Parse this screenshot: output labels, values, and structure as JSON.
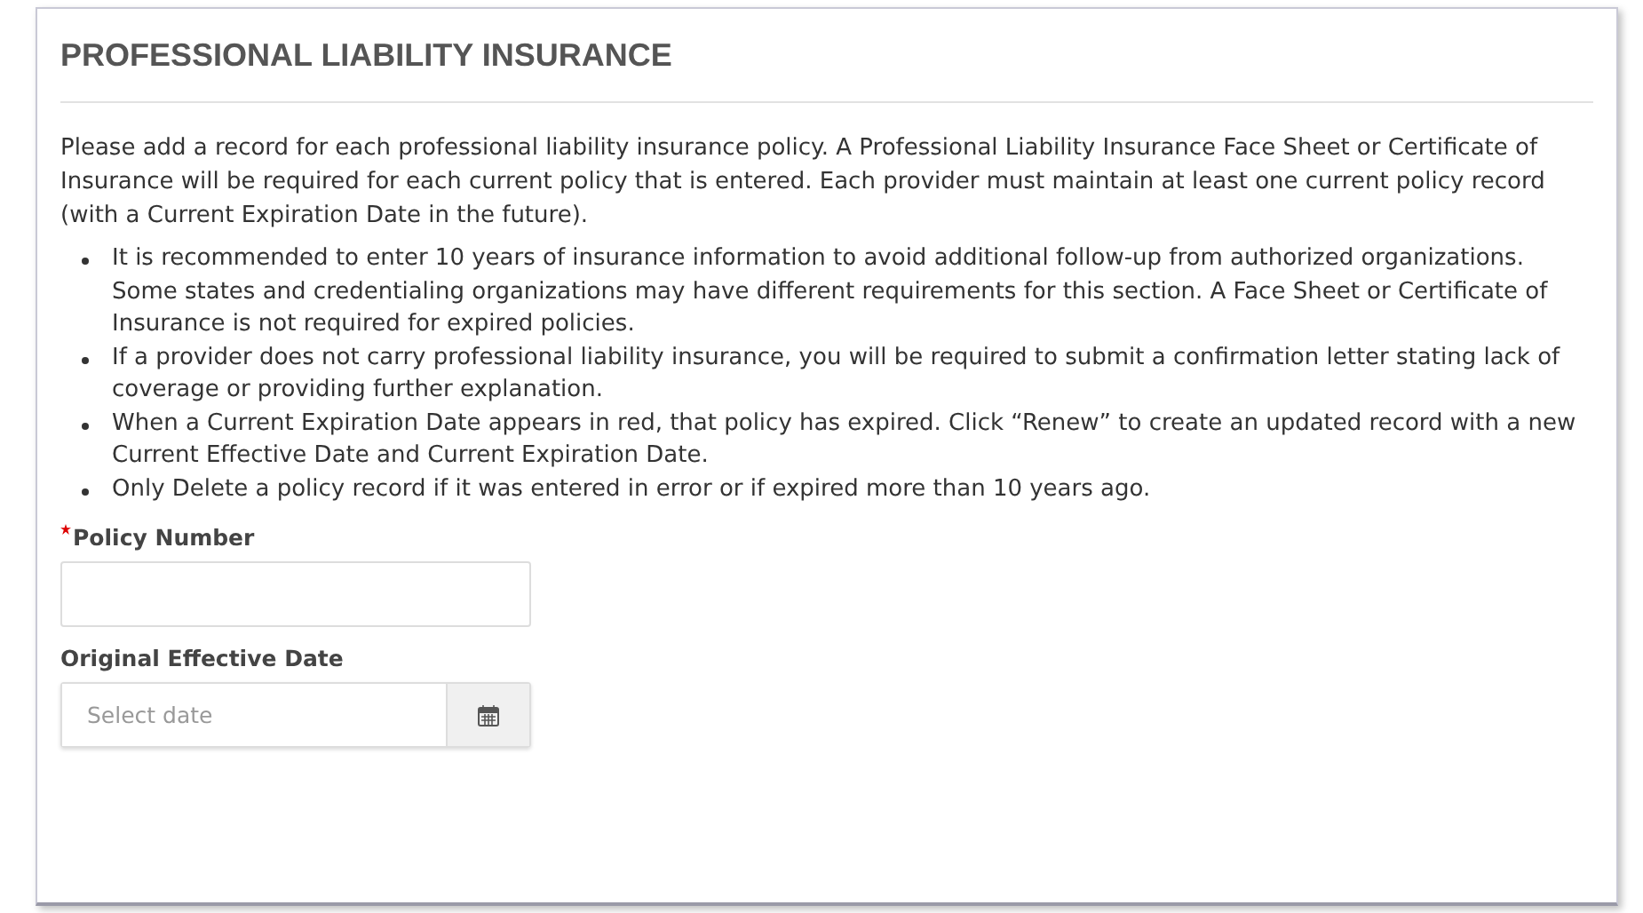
{
  "section": {
    "title": "PROFESSIONAL LIABILITY INSURANCE",
    "intro": "Please add a record for each professional liability insurance policy. A Professional Liability Insurance Face Sheet or Certificate of Insurance will be required for each current policy that is entered. Each provider must maintain at least one current policy record (with a Current Expiration Date in the future).",
    "bullets": [
      "It is recommended to enter 10 years of insurance information to avoid additional follow-up from authorized organizations. Some states and credentialing organizations may have different requirements for this section. A Face Sheet or Certificate of Insurance is not required for expired policies.",
      "If a provider does not carry professional liability insurance, you will be required to submit a confirmation letter stating lack of coverage or providing further explanation.",
      "When a Current Expiration Date appears in red, that policy has expired. Click “Renew” to create an updated record with a new Current Effective Date and Current Expiration Date.",
      "Only Delete a policy record if it was entered in error or if expired more than 10 years ago."
    ],
    "fields": [
      {
        "kind": "text",
        "label": "Policy Number",
        "required": true
      },
      {
        "kind": "date",
        "label": "Original Effective Date",
        "required": false,
        "placeholder": "Select date"
      }
    ]
  }
}
